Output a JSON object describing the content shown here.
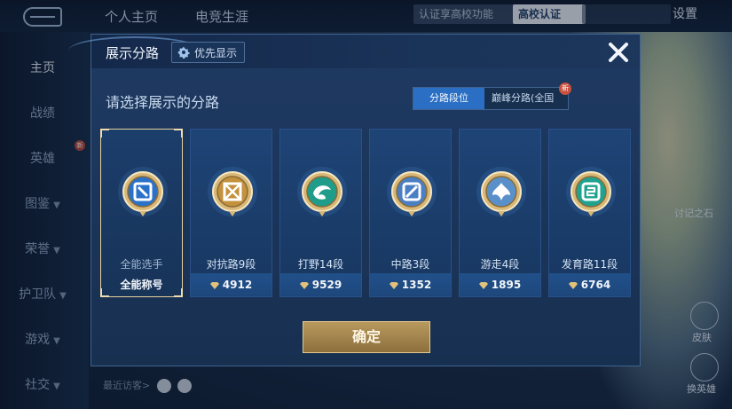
{
  "topbar": {
    "tabs": [
      "个人主页",
      "电竞生涯"
    ],
    "notice": "认证享高校功能",
    "school_badge": "高校认证",
    "settings": "设置"
  },
  "sidebar": {
    "items": [
      {
        "label": "主页",
        "active": true
      },
      {
        "label": "战绩"
      },
      {
        "label": "英雄"
      },
      {
        "label": "图鉴"
      },
      {
        "label": "荣誉"
      },
      {
        "label": "护卫队"
      },
      {
        "label": "游戏"
      },
      {
        "label": "社交"
      }
    ],
    "new_badge": "新"
  },
  "footer": {
    "recent_visitors": "最近访客>"
  },
  "right_panel": {
    "label_1": "讨记之石",
    "label_2": "皮肤",
    "label_3": "换英雄"
  },
  "modal": {
    "title": "展示分路",
    "priority_label": "优先显示",
    "subtitle": "请选择展示的分路",
    "toggle": {
      "left": "分路段位",
      "right": "巅峰分路(全国",
      "new_badge": "新"
    },
    "cards": [
      {
        "name": "全能选手",
        "score": "全能称号",
        "selected": true,
        "color": "#2a71c9"
      },
      {
        "name": "对抗路9段",
        "score": "4912",
        "color": "#c4913c"
      },
      {
        "name": "打野14段",
        "score": "9529",
        "color": "#1f9c8a"
      },
      {
        "name": "中路3段",
        "score": "1352",
        "color": "#4b7fc4"
      },
      {
        "name": "游走4段",
        "score": "1895",
        "color": "#5a90c9"
      },
      {
        "name": "发育路11段",
        "score": "6764",
        "color": "#1fa28f"
      }
    ],
    "confirm_label": "确定"
  }
}
